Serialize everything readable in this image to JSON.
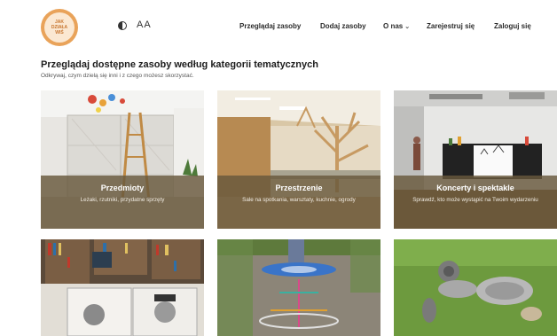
{
  "header": {
    "logo_text": [
      "JAK",
      "DZIAŁA",
      "WIŚ"
    ],
    "font_size_label": "AA",
    "nav": {
      "browse": "Przeglądaj zasoby",
      "add": "Dodaj zasoby",
      "about": "O nas",
      "register": "Zarejestruj się",
      "login": "Zaloguj się"
    }
  },
  "main": {
    "title": "Przeglądaj dostępne zasoby według kategorii tematycznych",
    "subtitle": "Odkrywaj, czym dzielą się inni i z czego możesz skorzystać."
  },
  "categories": [
    {
      "title": "Przedmioty",
      "desc": "Leżaki, rzutniki, przydatne sprzęty"
    },
    {
      "title": "Przestrzenie",
      "desc": "Sale na spotkania, warsztaty, kuchnie, ogrody"
    },
    {
      "title": "Koncerty i spektakle",
      "desc": "Sprawdź, kto może wystąpić na Twoim wydarzeniu"
    },
    {
      "title": "",
      "desc": ""
    },
    {
      "title": "",
      "desc": ""
    },
    {
      "title": "",
      "desc": ""
    }
  ]
}
